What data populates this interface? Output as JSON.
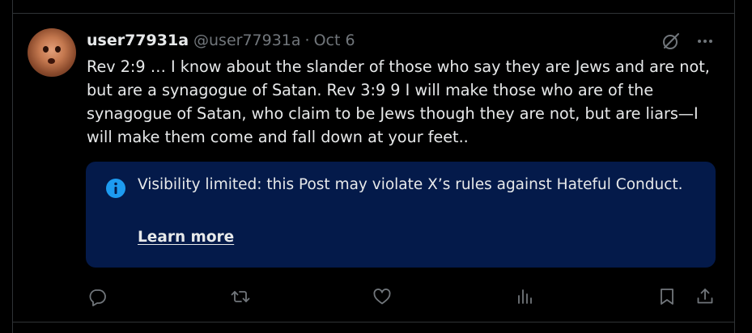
{
  "post": {
    "display_name": "user77931a",
    "handle": "@user77931a",
    "separator": "·",
    "date": "Oct 6",
    "text": "Rev 2:9 … I know about the slander of those who say they are Jews and are not, but are a synagogue of Satan. Rev 3:9 9 I will make those who are of the synagogue of Satan, who claim to be Jews though they are not, but are liars—I will make them come and fall down at your feet.."
  },
  "notice": {
    "message": "Visibility limited: this Post may violate X’s rules against Hateful Conduct.",
    "link_label": "Learn more",
    "background": "#041a4a",
    "icon_color": "#1d9bf0"
  },
  "icons": {
    "header": [
      "grok-icon",
      "more-icon"
    ],
    "actions": [
      "reply-icon",
      "repost-icon",
      "like-icon",
      "views-icon",
      "bookmark-icon",
      "share-icon"
    ]
  },
  "colors": {
    "background": "#000000",
    "text": "#e7e9ea",
    "secondary": "#71767b",
    "border": "#2f3336"
  }
}
